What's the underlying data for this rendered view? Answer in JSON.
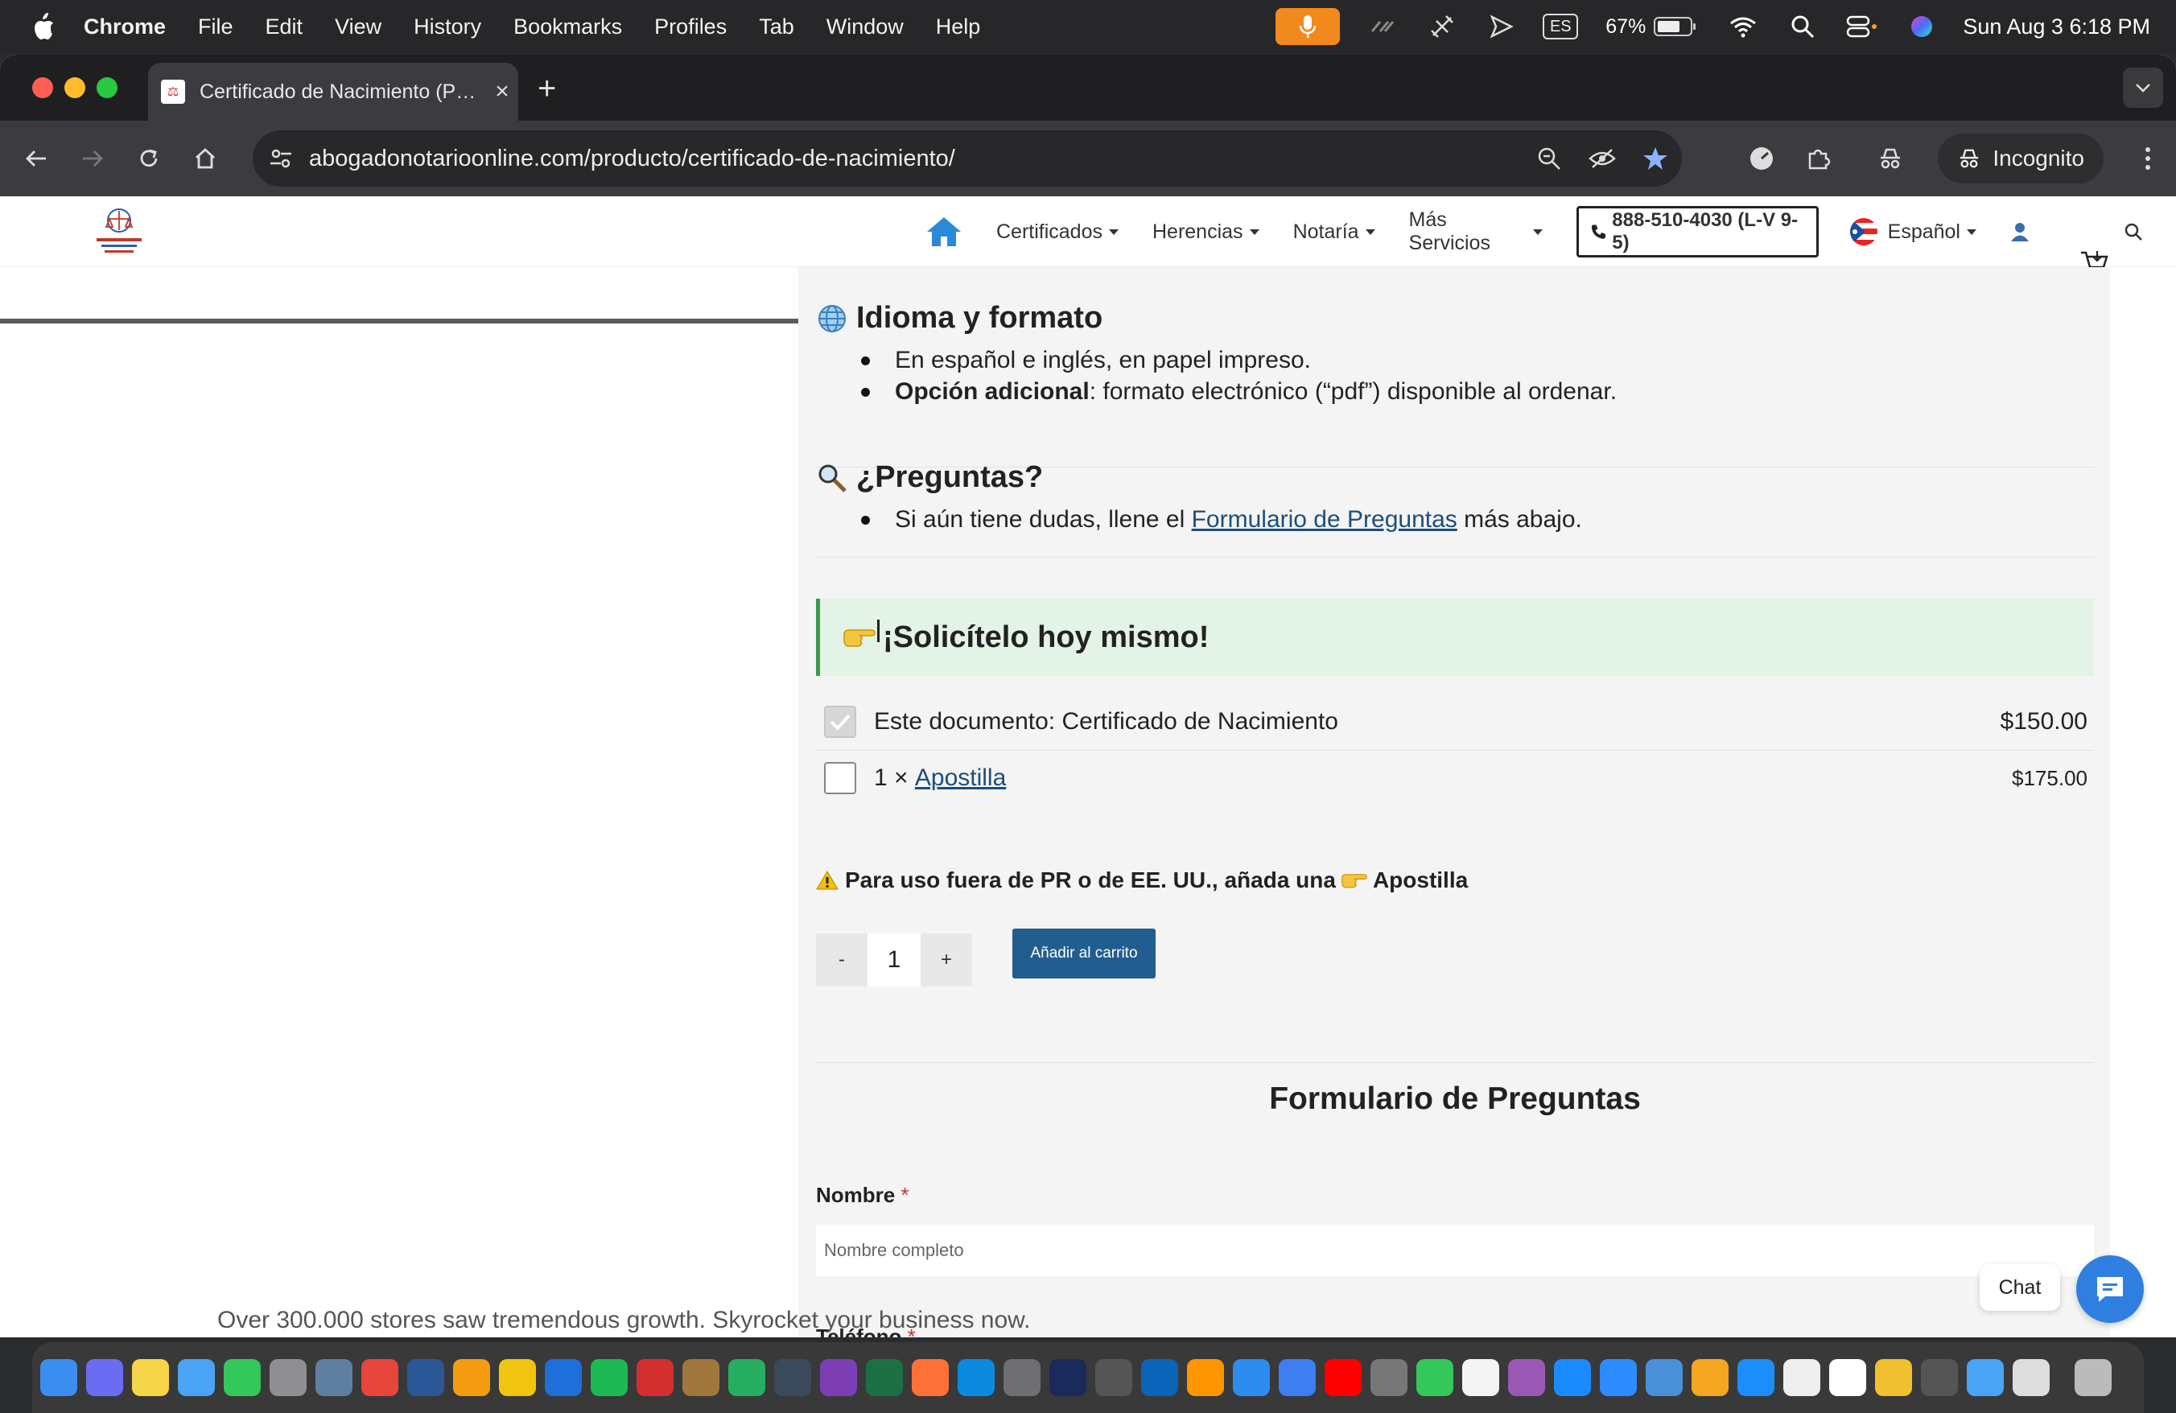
{
  "menubar": {
    "app": "Chrome",
    "items": [
      "File",
      "Edit",
      "View",
      "History",
      "Bookmarks",
      "Profiles",
      "Tab",
      "Window",
      "Help"
    ],
    "input_source": "ES",
    "battery": "67%",
    "battery_level": 0.67,
    "datetime": "Sun Aug 3  6:18 PM"
  },
  "browser": {
    "tab_title": "Certificado de Nacimiento (P…",
    "url": "abogadonotarioonline.com/producto/certificado-de-nacimiento/",
    "incognito_label": "Incognito"
  },
  "site": {
    "nav": [
      "Certificados",
      "Herencias",
      "Notaría",
      "Más Servicios"
    ],
    "phone": "888-510-4030 (L-V 9-5)",
    "language": "Español",
    "reading_progress": 0.375
  },
  "content": {
    "idioma": {
      "title": "Idioma y formato",
      "bullet1": "En español e inglés, en papel impreso.",
      "bullet2_bold": "Opción adicional",
      "bullet2_rest": ": formato electrónico (“pdf”) disponible al ordenar."
    },
    "preguntas": {
      "title": "¿Preguntas?",
      "text_before": "Si aún tiene dudas, llene el ",
      "link": "Formulario de Preguntas",
      "text_after": " más abajo."
    },
    "callout": "¡Solicítelo hoy mismo!",
    "items": [
      {
        "label": "Este documento: Certificado de Nacimiento",
        "price": "$150.00",
        "checked": true
      },
      {
        "prefix": "1 × ",
        "link": "Apostilla",
        "price": "$175.00",
        "checked": false
      }
    ],
    "warning": {
      "text": "Para uso fuera de PR o de EE. UU., añada una",
      "link": "Apostilla"
    },
    "quantity": {
      "minus": "-",
      "value": "1",
      "plus": "+"
    },
    "add_to_cart": "Añadir al carrito",
    "form": {
      "title": "Formulario de Preguntas",
      "name_label": "Nombre",
      "name_placeholder": "Nombre completo",
      "phone_label": "Teléfono",
      "required_mark": "*"
    }
  },
  "chat": {
    "label": "Chat"
  },
  "overlay_text": "Over 300.000 stores saw tremendous growth. Skyrocket your business now."
}
